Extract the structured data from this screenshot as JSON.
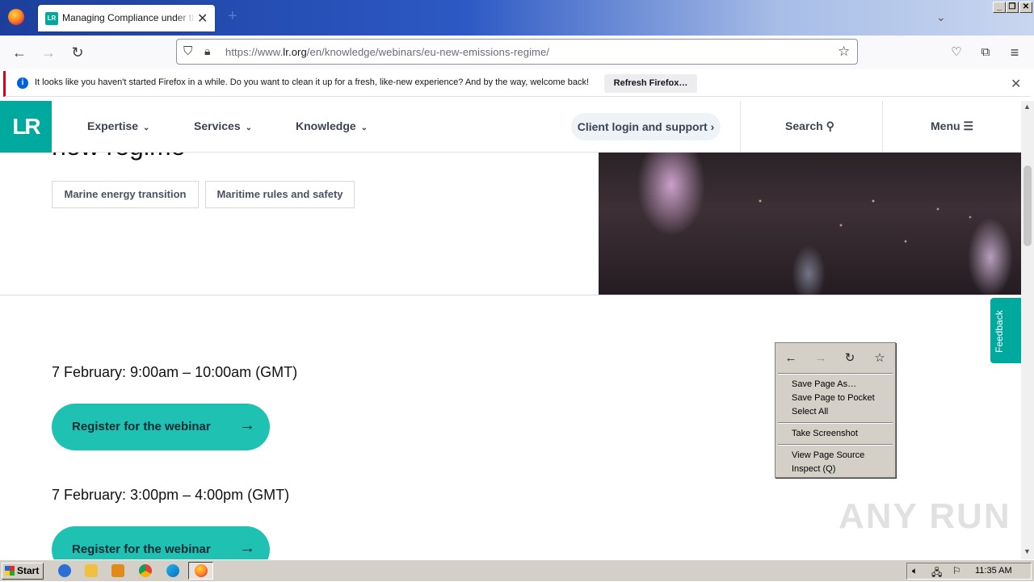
{
  "browser": {
    "tab_title": "Managing Compliance under the EU",
    "tab_close_glyph": "✕",
    "new_tab_glyph": "+",
    "url_prefix": "https://www.",
    "url_host": "lr.org",
    "url_path": "/en/knowledge/webinars/eu-new-emissions-regime/",
    "window_buttons": [
      "_",
      "❐",
      "✕"
    ]
  },
  "notification": {
    "text": "It looks like you haven't started Firefox in a while. Do you want to clean it up for a fresh, like-new experience? And by the way, welcome back!",
    "button": "Refresh Firefox…",
    "info_glyph": "i",
    "close_glyph": "✕"
  },
  "site": {
    "logo_text": "LR",
    "nav": [
      {
        "label": "Expertise"
      },
      {
        "label": "Services"
      },
      {
        "label": "Knowledge"
      }
    ],
    "client_login": "Client login and support",
    "search": "Search",
    "menu": "Menu",
    "hero_title_partial": "new regime",
    "tags": [
      "Marine energy transition",
      "Maritime rules and safety"
    ],
    "sessions": [
      {
        "time": "7 February: 9:00am – 10:00am (GMT)",
        "button": "Register for the webinar"
      },
      {
        "time": "7 February: 3:00pm – 4:00pm (GMT)",
        "button": "Register for the webinar"
      }
    ],
    "feedback": "Feedback"
  },
  "context_menu": {
    "items_group1": [
      "Save Page As…",
      "Save Page to Pocket",
      "Select All"
    ],
    "items_group2": [
      "Take Screenshot"
    ],
    "items_group3": [
      "View Page Source",
      "Inspect (Q)"
    ]
  },
  "watermark": "ANY RUN",
  "taskbar": {
    "start": "Start",
    "clock": "11:35 AM"
  },
  "colors": {
    "brand_teal": "#00a99d",
    "button_teal": "#1fc1b3",
    "notification_accent": "#d70022"
  }
}
